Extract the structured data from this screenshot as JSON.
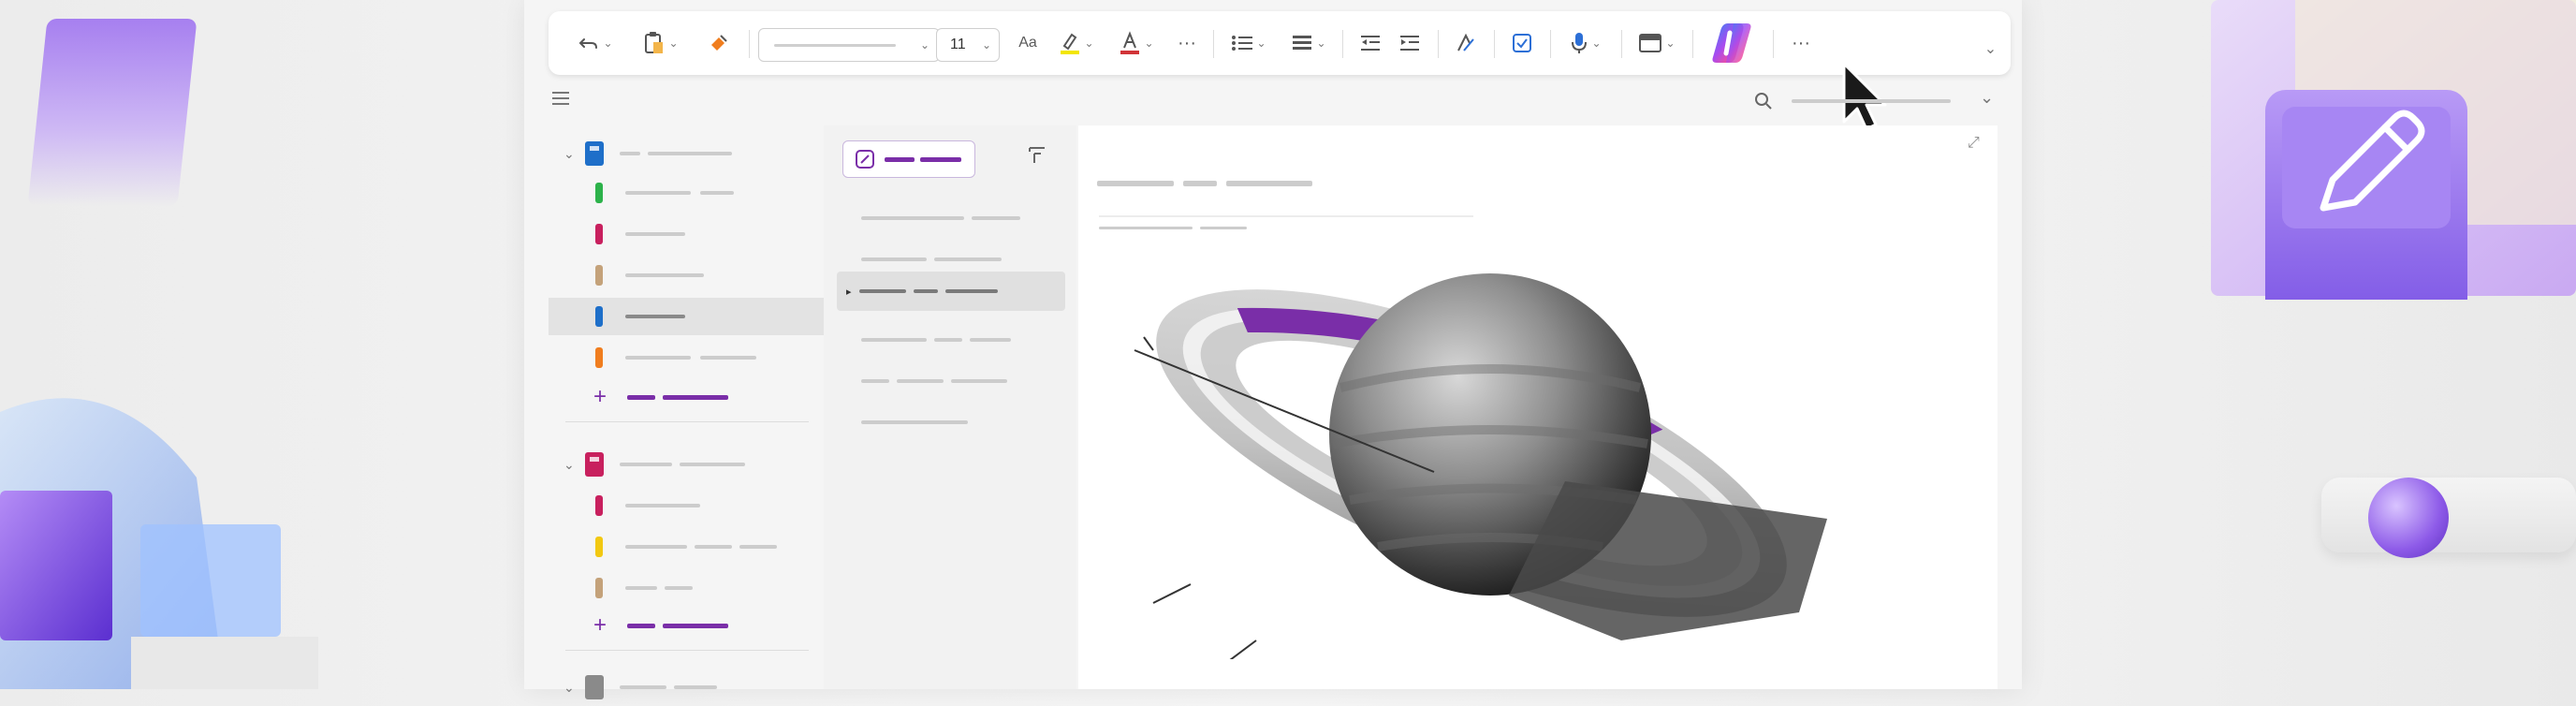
{
  "ribbon": {
    "undo_icon": "undo-icon",
    "paste_icon": "paste-icon",
    "format_painter_icon": "format-painter-icon",
    "font_size": "11",
    "more_label": "···",
    "overflow_label": "···"
  },
  "colors": {
    "accent": "#7a2ea8",
    "highlight": "#f2e600",
    "font_color": "#d13438",
    "copilot": "#e94fa6"
  },
  "sidebar": {
    "notebooks": [
      {
        "color": "#1e6fc9",
        "sections": [
          "#2cb24a",
          "#c8205e",
          "#c4a27a",
          "#1e6fc9",
          "#f07d1e"
        ],
        "selected_section": 3
      },
      {
        "color": "#c8205e",
        "sections": [
          "#c8205e",
          "#f2c811",
          "#c4a27a"
        ],
        "selected_section": -1
      },
      {
        "color": "#8a8a8a",
        "sections": [],
        "selected_section": -1
      }
    ]
  },
  "pagelist": {
    "selected_page": 2
  }
}
